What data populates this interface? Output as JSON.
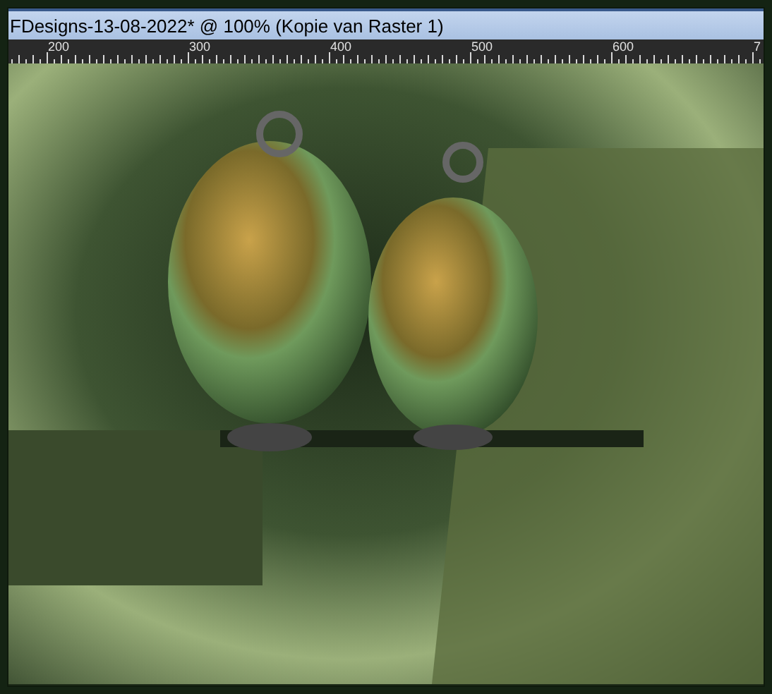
{
  "window": {
    "title": "FDesigns-13-08-2022* @ 100% (Kopie van Raster 1)"
  },
  "ruler": {
    "labels": [
      "200",
      "300",
      "400",
      "500",
      "600",
      "7"
    ]
  }
}
